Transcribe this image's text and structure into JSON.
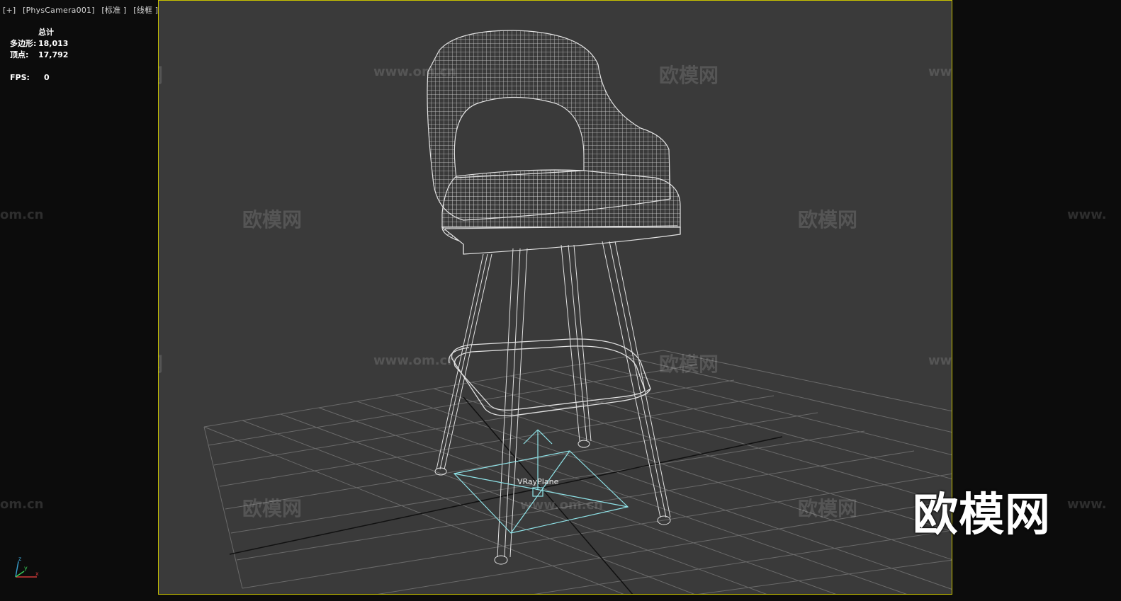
{
  "viewport_label": {
    "plus": "[+]",
    "camera": "[PhysCamera001]",
    "shading": "[标准 ]",
    "mode": "[线框 ]"
  },
  "stats": {
    "total_label": "总计",
    "polygons_label": "多边形:",
    "polygons_value": "18,013",
    "vertices_label": "顶点:",
    "vertices_value": "17,792",
    "fps_label": "FPS:",
    "fps_value": "0"
  },
  "scene": {
    "object_label": "VRayPlane",
    "watermark_cn": "欧模网",
    "watermark_url": "www.om.cn",
    "watermark_url_cut": "om.cn",
    "watermark_url_cut_right": "www.",
    "big_watermark": "欧模网"
  },
  "axis_gizmo": {
    "x": "x",
    "y": "y",
    "z": "z"
  },
  "colors": {
    "viewport_bg": "#3a3a3a",
    "viewport_border": "#c8c200",
    "wire": "#e0e0e0",
    "helper": "#8fe3e8"
  }
}
